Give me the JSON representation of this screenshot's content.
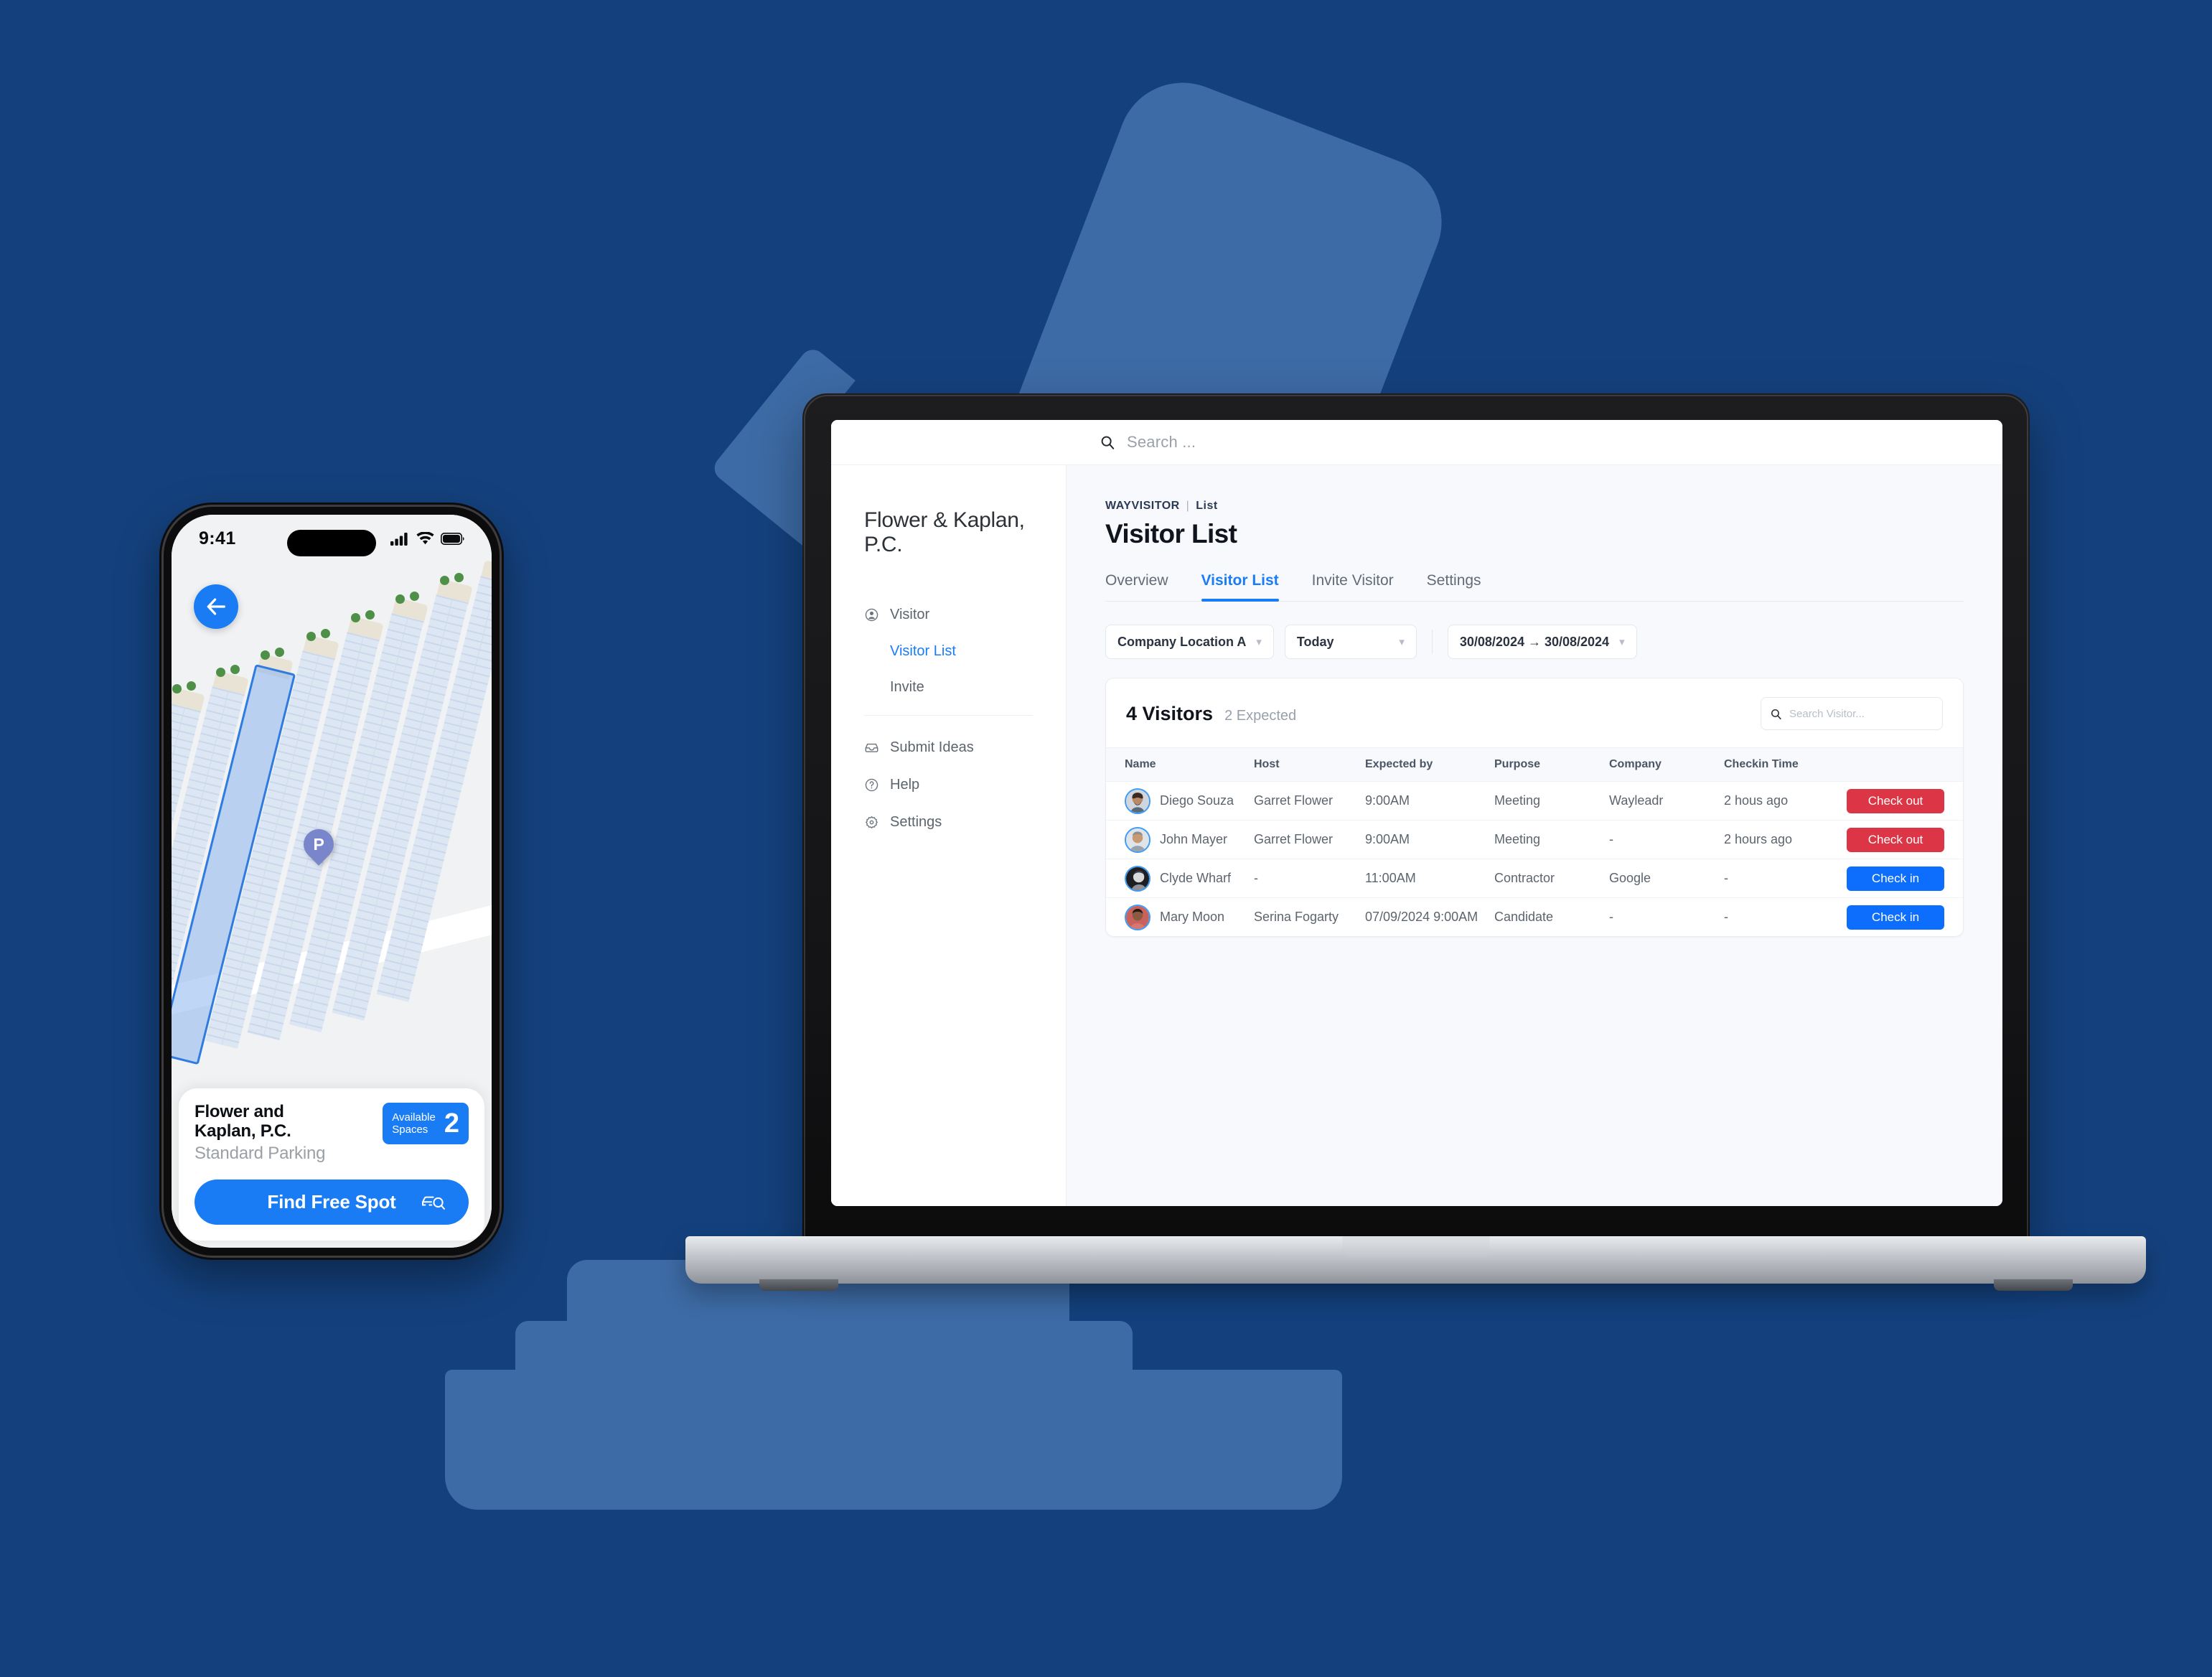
{
  "desktop": {
    "top_search": {
      "placeholder": "Search ...",
      "icon": "search-icon"
    },
    "sidebar": {
      "brand": "Flower & Kaplan, P.C.",
      "items": [
        {
          "label": "Visitor",
          "icon": "user-circle-icon"
        },
        {
          "label": "Visitor List",
          "icon": "",
          "sub": true,
          "active": true
        },
        {
          "label": "Invite",
          "icon": "",
          "sub": true,
          "active": false
        },
        {
          "label": "Submit Ideas",
          "icon": "inbox-icon"
        },
        {
          "label": "Help",
          "icon": "question-circle-icon"
        },
        {
          "label": "Settings",
          "icon": "gear-icon"
        }
      ]
    },
    "breadcrumb": {
      "app": "WAYVISITOR",
      "separator": "|",
      "section": "List"
    },
    "page_title": "Visitor List",
    "tabs": [
      {
        "label": "Overview",
        "active": false
      },
      {
        "label": "Visitor List",
        "active": true
      },
      {
        "label": "Invite Visitor",
        "active": false
      },
      {
        "label": "Settings",
        "active": false
      }
    ],
    "filters": [
      {
        "label": "Company Location A",
        "caret": "chevron-down-icon"
      },
      {
        "label": "Today",
        "caret": "chevron-down-icon"
      },
      {
        "label": "30/08/2024 → 30/08/2024",
        "caret": "chevron-down-icon"
      }
    ],
    "card": {
      "count_label": "4 Visitors",
      "expected_label": "2 Expected",
      "search_placeholder": "Search Visitor...",
      "columns": [
        "Name",
        "Host",
        "Expected by",
        "Purpose",
        "Company",
        "Checkin Time",
        ""
      ],
      "rows": [
        {
          "name": "Diego Souza",
          "host": "Garret Flower",
          "expected_by": "9:00AM",
          "purpose": "Meeting",
          "company": "Wayleadr",
          "checkin_time": "2 hous ago",
          "action": "Check out",
          "action_type": "out"
        },
        {
          "name": "John Mayer",
          "host": "Garret Flower",
          "expected_by": "9:00AM",
          "purpose": "Meeting",
          "company": "-",
          "checkin_time": "2 hours ago",
          "action": "Check out",
          "action_type": "out"
        },
        {
          "name": "Clyde Wharf",
          "host": "-",
          "expected_by": "11:00AM",
          "purpose": "Contractor",
          "company": "Google",
          "checkin_time": "-",
          "action": "Check in",
          "action_type": "in"
        },
        {
          "name": "Mary Moon",
          "host": "Serina Fogarty",
          "expected_by": "07/09/2024 9:00AM",
          "purpose": "Candidate",
          "company": "-",
          "checkin_time": "-",
          "action": "Check in",
          "action_type": "in"
        }
      ]
    }
  },
  "phone": {
    "status": {
      "time": "9:41",
      "icons": [
        "cellular-signal-icon",
        "wifi-icon",
        "battery-icon"
      ]
    },
    "back_icon": "arrow-left-icon",
    "map": {
      "pin_label": "P",
      "pin_icon": "parking-pin-icon"
    },
    "sheet": {
      "title_line1": "Flower and",
      "title_line2": "Kaplan, P.C.",
      "subtitle": "Standard Parking",
      "spaces_label_line1": "Available",
      "spaces_label_line2": "Spaces",
      "spaces_value": "2",
      "cta_label": "Find Free Spot",
      "cta_icon": "car-search-icon"
    }
  },
  "colors": {
    "background": "#14417d",
    "background_shape": "#3d6ba5",
    "accent_blue": "#1a7cf5",
    "button_blue": "#0d6efd",
    "button_red": "#dc3545"
  }
}
